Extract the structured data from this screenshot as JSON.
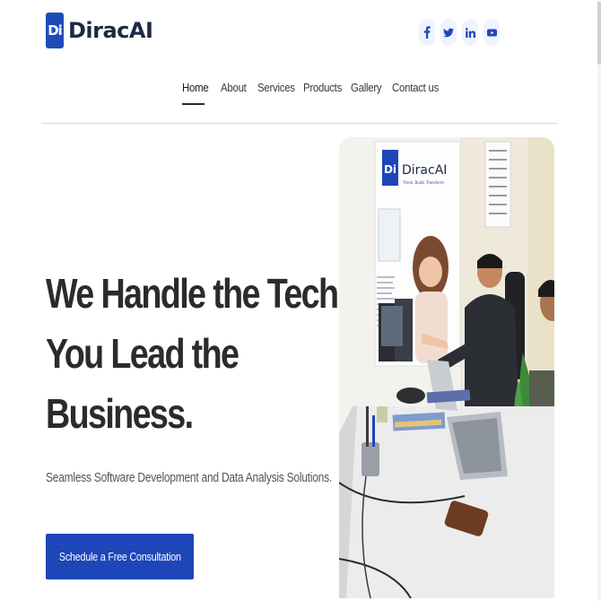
{
  "brand": {
    "logo_mark": "Di",
    "name": "DiracAI",
    "banner_tagline": "Think. Build. Transform"
  },
  "social": [
    {
      "icon": "facebook-icon",
      "label": "f"
    },
    {
      "icon": "twitter-icon",
      "label": "t"
    },
    {
      "icon": "linkedin-icon",
      "label": "in"
    },
    {
      "icon": "youtube-icon",
      "label": "yt"
    }
  ],
  "nav": {
    "items": [
      {
        "label": "Home",
        "active": true
      },
      {
        "label": "About"
      },
      {
        "label": "Services"
      },
      {
        "label": "Products"
      },
      {
        "label": "Gallery"
      },
      {
        "label": "Contact us"
      }
    ]
  },
  "hero": {
    "headline_lines": [
      "We Handle the Tech,",
      "You Lead the",
      "Business."
    ],
    "subtitle": "Seamless Software Development and Data Analysis Solutions.",
    "cta_label": "Schedule a Free Consultation"
  },
  "colors": {
    "brand_blue": "#1f46b8",
    "text_dark": "#2b2b2b",
    "divider": "#d6d6d6"
  }
}
